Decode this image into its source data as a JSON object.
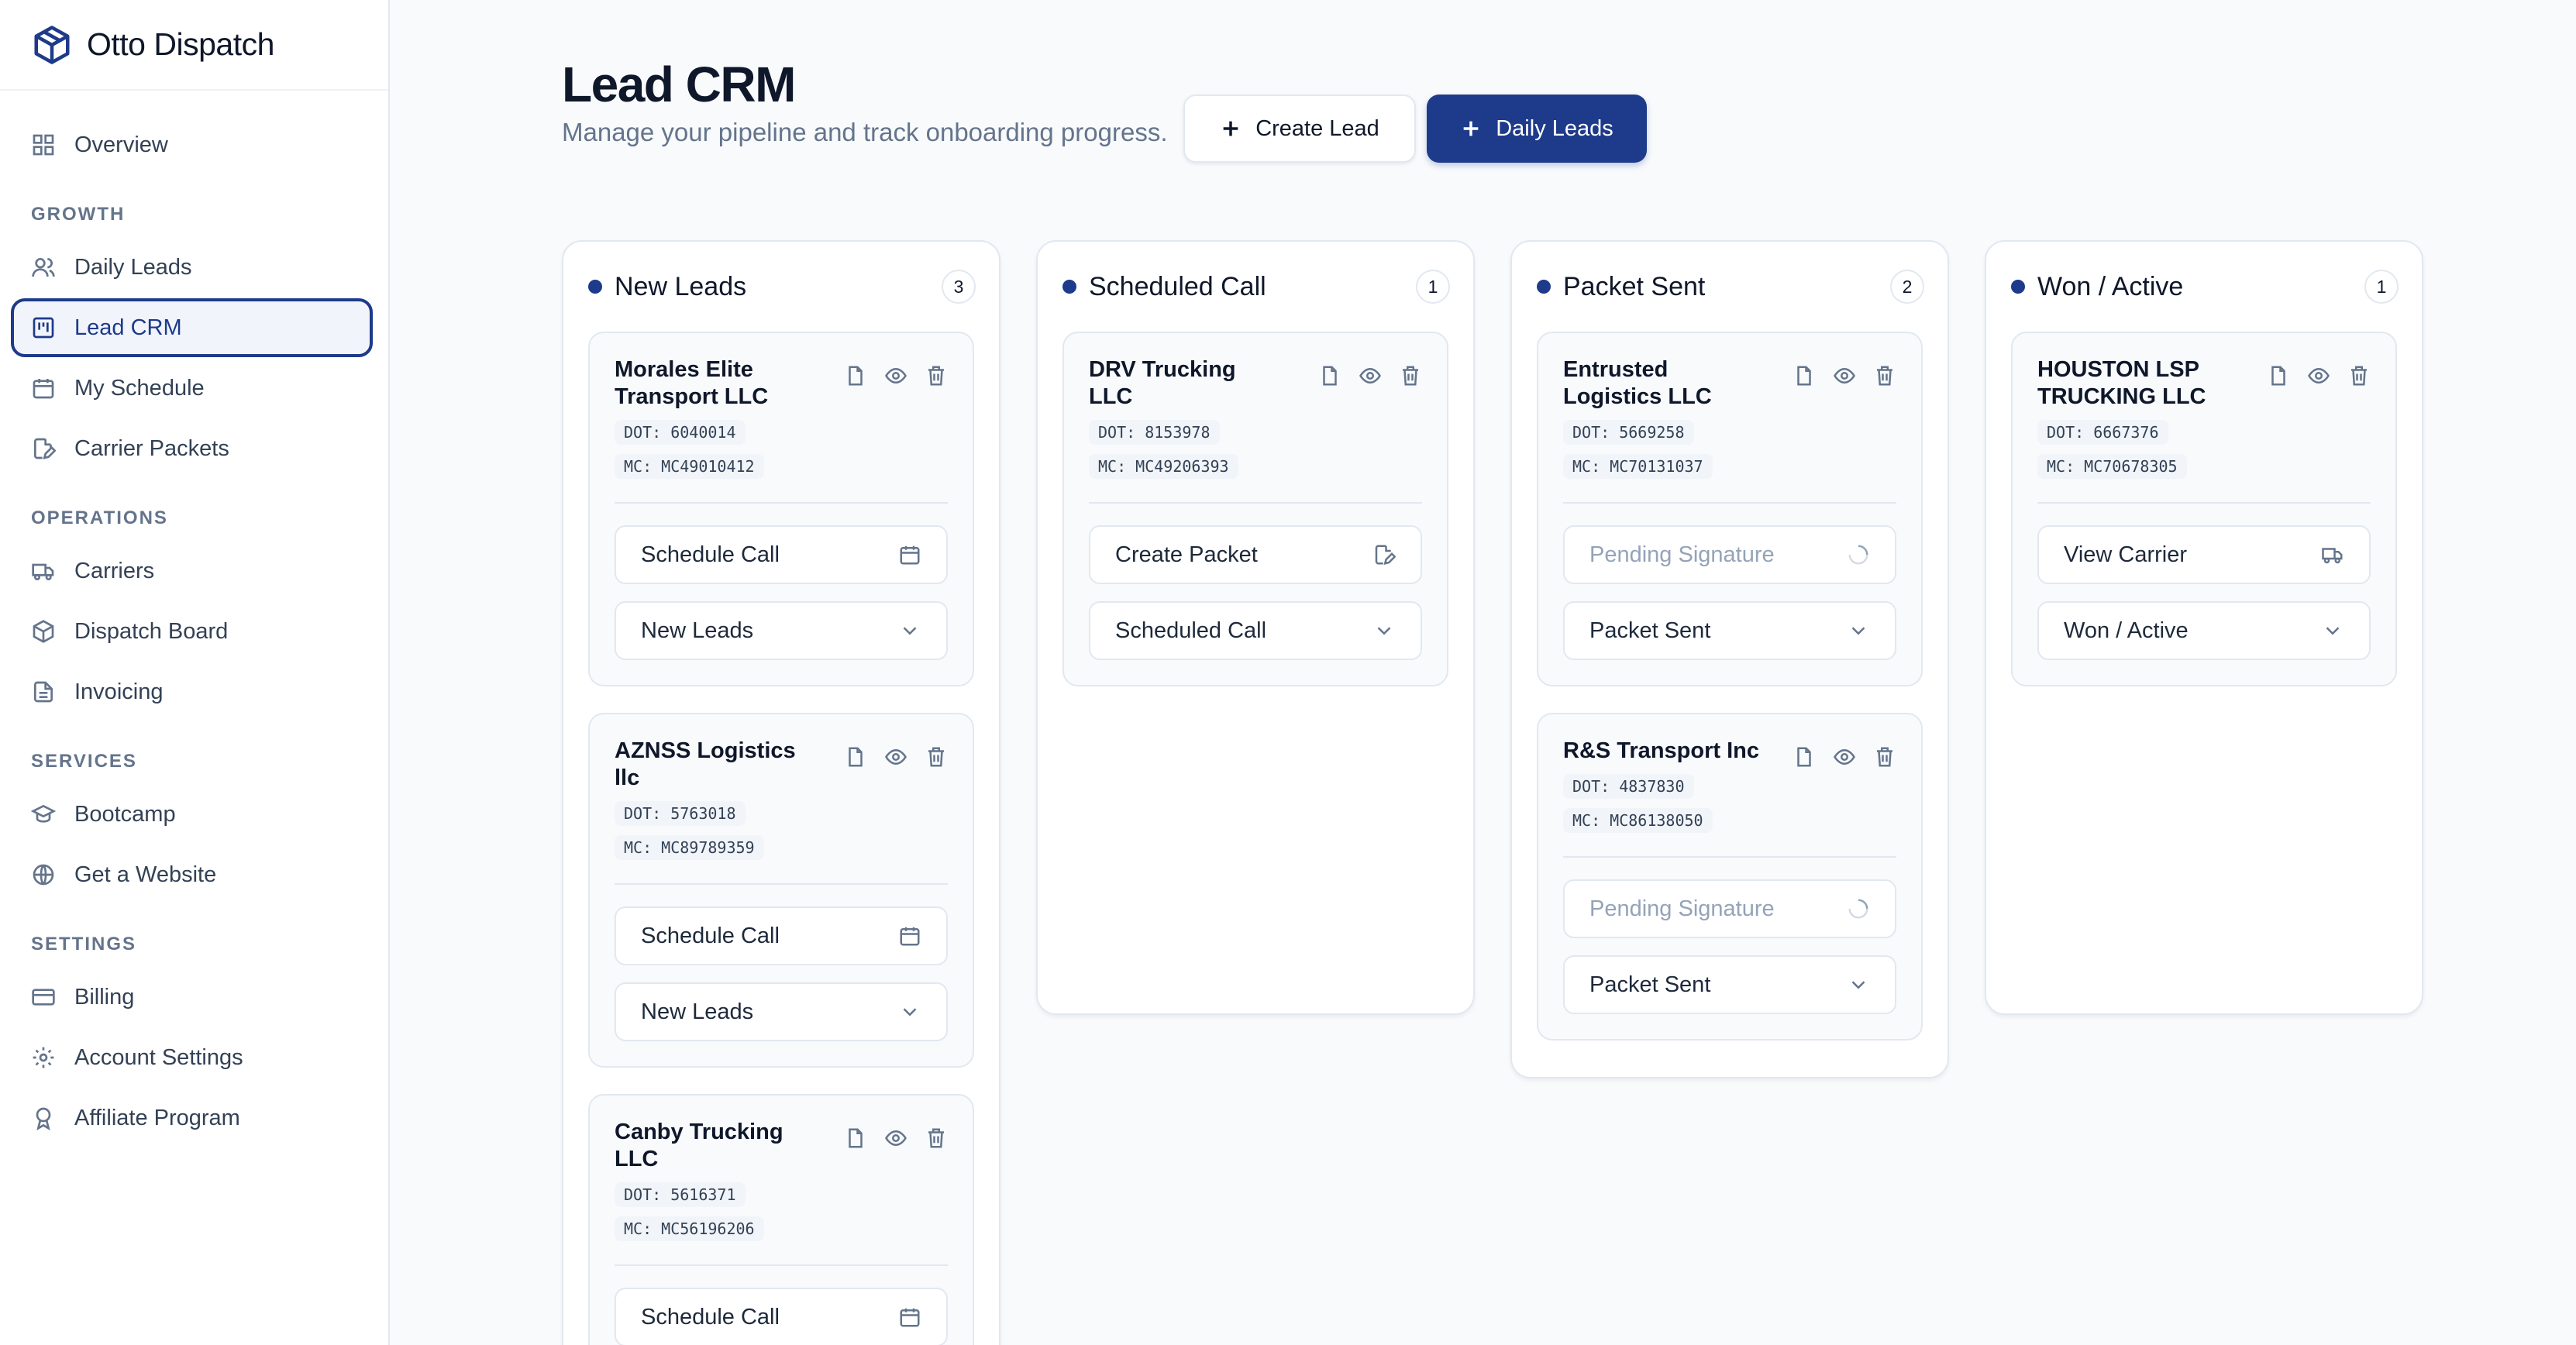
{
  "app": {
    "name": "Otto Dispatch"
  },
  "sidebar": {
    "top": [
      {
        "label": "Overview",
        "icon": "overview-icon"
      }
    ],
    "sections": [
      {
        "title": "GROWTH",
        "items": [
          {
            "label": "Daily Leads",
            "icon": "users-icon",
            "active": false
          },
          {
            "label": "Lead CRM",
            "icon": "kanban-icon",
            "active": true
          },
          {
            "label": "My Schedule",
            "icon": "calendar-icon",
            "active": false
          },
          {
            "label": "Carrier Packets",
            "icon": "file-edit-icon",
            "active": false
          }
        ]
      },
      {
        "title": "OPERATIONS",
        "items": [
          {
            "label": "Carriers",
            "icon": "truck-icon"
          },
          {
            "label": "Dispatch Board",
            "icon": "box-icon"
          },
          {
            "label": "Invoicing",
            "icon": "document-icon"
          }
        ]
      },
      {
        "title": "SERVICES",
        "items": [
          {
            "label": "Bootcamp",
            "icon": "graduation-cap-icon"
          },
          {
            "label": "Get a Website",
            "icon": "globe-icon"
          }
        ]
      },
      {
        "title": "SETTINGS",
        "items": [
          {
            "label": "Billing",
            "icon": "credit-card-icon"
          },
          {
            "label": "Account Settings",
            "icon": "gear-icon"
          },
          {
            "label": "Affiliate Program",
            "icon": "award-icon"
          }
        ]
      }
    ]
  },
  "header": {
    "title": "Lead CRM",
    "subtitle": "Manage your pipeline and track onboarding progress.",
    "create_lead_label": "Create Lead",
    "daily_leads_label": "Daily Leads"
  },
  "columns": [
    {
      "title": "New Leads",
      "count": "3",
      "cards": [
        {
          "name": "Morales Elite Transport LLC",
          "dot": "DOT: 6040014",
          "mc": "MC: MC49010412",
          "action": "Schedule Call",
          "action_icon": "calendar",
          "action_disabled": false,
          "status": "New Leads"
        },
        {
          "name": "AZNSS Logistics llc",
          "dot": "DOT: 5763018",
          "mc": "MC: MC89789359",
          "action": "Schedule Call",
          "action_icon": "calendar",
          "action_disabled": false,
          "status": "New Leads"
        },
        {
          "name": "Canby Trucking LLC",
          "dot": "DOT: 5616371",
          "mc": "MC: MC56196206",
          "action": "Schedule Call",
          "action_icon": "calendar",
          "action_disabled": false,
          "status": ""
        }
      ]
    },
    {
      "title": "Scheduled Call",
      "count": "1",
      "cards": [
        {
          "name": "DRV Trucking LLC",
          "dot": "DOT: 8153978",
          "mc": "MC: MC49206393",
          "action": "Create Packet",
          "action_icon": "file-edit",
          "action_disabled": false,
          "status": "Scheduled Call"
        }
      ]
    },
    {
      "title": "Packet Sent",
      "count": "2",
      "cards": [
        {
          "name": "Entrusted Logistics LLC",
          "dot": "DOT: 5669258",
          "mc": "MC: MC70131037",
          "action": "Pending Signature",
          "action_icon": "spinner",
          "action_disabled": true,
          "status": "Packet Sent"
        },
        {
          "name": "R&S Transport Inc",
          "dot": "DOT: 4837830",
          "mc": "MC: MC86138050",
          "action": "Pending Signature",
          "action_icon": "spinner",
          "action_disabled": true,
          "status": "Packet Sent"
        }
      ]
    },
    {
      "title": "Won / Active",
      "count": "1",
      "cards": [
        {
          "name": "HOUSTON LSP TRUCKING LLC",
          "dot": "DOT: 6667376",
          "mc": "MC: MC70678305",
          "action": "View Carrier",
          "action_icon": "truck",
          "action_disabled": false,
          "status": "Won / Active"
        }
      ]
    }
  ],
  "colors": {
    "accent": "#1e3a8a",
    "border": "#e2e8f0",
    "muted": "#64748b"
  }
}
